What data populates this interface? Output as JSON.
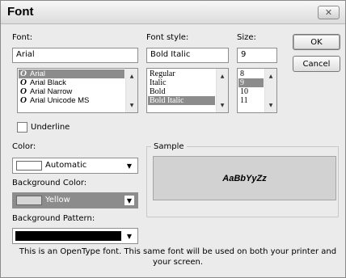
{
  "title": "Font",
  "close_glyph": "✕",
  "font": {
    "label": "Font:",
    "value": "Arial",
    "items": [
      {
        "name": "Arial",
        "selected": true
      },
      {
        "name": "Arial Black",
        "selected": false
      },
      {
        "name": "Arial Narrow",
        "selected": false
      },
      {
        "name": "Arial Unicode MS",
        "selected": false
      }
    ],
    "type_glyph": "O"
  },
  "style": {
    "label": "Font style:",
    "value": "Bold Italic",
    "items": [
      "Regular",
      "Italic",
      "Bold",
      "Bold Italic"
    ],
    "selected": "Bold Italic"
  },
  "size": {
    "label": "Size:",
    "value": "9",
    "items": [
      "8",
      "9",
      "10",
      "11"
    ],
    "selected": "9"
  },
  "buttons": {
    "ok": "OK",
    "cancel": "Cancel"
  },
  "underline": {
    "label": "Underline",
    "checked": false
  },
  "color": {
    "label": "Color:",
    "value": "Automatic",
    "swatch": "#ffffff"
  },
  "background_color": {
    "label": "Background Color:",
    "value": "Yellow",
    "swatch": "#d6d6d6",
    "field_bg": "#8c8c8c"
  },
  "background_pattern": {
    "label": "Background Pattern:",
    "swatch": "#000000"
  },
  "sample": {
    "label": "Sample",
    "text": "AaBbYyZz"
  },
  "info": "This is an OpenType font. This same font will be used on both your printer and your screen."
}
